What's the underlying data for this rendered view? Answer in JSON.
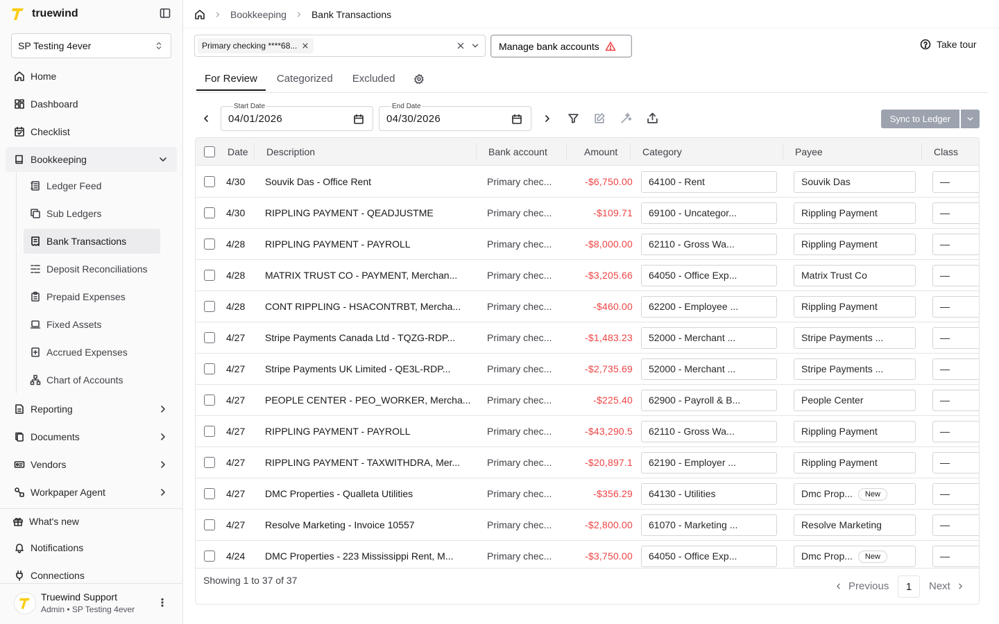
{
  "brand": {
    "name": "truewind",
    "accent": "#facc15"
  },
  "org_selector": {
    "value": "SP Testing 4ever"
  },
  "nav": {
    "home": "Home",
    "dashboard": "Dashboard",
    "checklist": "Checklist",
    "bookkeeping": "Bookkeeping",
    "bookkeeping_sub": [
      {
        "label": "Ledger Feed",
        "icon": "ledger-icon"
      },
      {
        "label": "Sub Ledgers",
        "icon": "copy-icon"
      },
      {
        "label": "Bank Transactions",
        "icon": "receipt-icon",
        "active": true
      },
      {
        "label": "Deposit Reconciliations",
        "icon": "reconcile-icon"
      },
      {
        "label": "Prepaid Expenses",
        "icon": "clipboard-icon"
      },
      {
        "label": "Fixed Assets",
        "icon": "laptop-icon"
      },
      {
        "label": "Accrued Expenses",
        "icon": "plus-file-icon"
      },
      {
        "label": "Chart of Accounts",
        "icon": "tree-icon"
      }
    ],
    "reporting": "Reporting",
    "documents": "Documents",
    "vendors": "Vendors",
    "workpaper_agent": "Workpaper Agent",
    "whats_new": "What's new",
    "notifications": "Notifications",
    "connections": "Connections"
  },
  "user": {
    "name": "Truewind Support",
    "role": "Admin • SP Testing 4ever"
  },
  "breadcrumb": {
    "parent": "Bookkeeping",
    "current": "Bank Transactions"
  },
  "account_filter": {
    "chip": "Primary checking ****68..."
  },
  "manage_button": "Manage bank accounts",
  "tour_button": "Take tour",
  "tabs": [
    "For Review",
    "Categorized",
    "Excluded"
  ],
  "dates": {
    "start_label": "Start Date",
    "start_value": "04/01/2026",
    "end_label": "End Date",
    "end_value": "04/30/2026"
  },
  "sync_button": "Sync to Ledger",
  "table": {
    "headers": {
      "date": "Date",
      "description": "Description",
      "bank": "Bank account",
      "amount": "Amount",
      "category": "Category",
      "payee": "Payee",
      "class": "Class"
    },
    "rows": [
      {
        "date": "4/30",
        "description": "Souvik Das - Office Rent",
        "bank": "Primary chec...",
        "amount": "-$6,750.00",
        "category": "64100 - Rent",
        "payee": "Souvik Das",
        "payee_new": "",
        "class": "—"
      },
      {
        "date": "4/30",
        "description": "RIPPLING PAYMENT - QEADJUSTME",
        "bank": "Primary chec...",
        "amount": "-$109.71",
        "category": "69100 - Uncategor...",
        "payee": "Rippling Payment",
        "payee_new": "",
        "class": "—"
      },
      {
        "date": "4/28",
        "description": "RIPPLING PAYMENT - PAYROLL",
        "bank": "Primary chec...",
        "amount": "-$8,000.00",
        "category": "62110 - Gross Wa...",
        "payee": "Rippling Payment",
        "payee_new": "",
        "class": "—"
      },
      {
        "date": "4/28",
        "description": "MATRIX TRUST CO - PAYMENT, Merchan...",
        "bank": "Primary chec...",
        "amount": "-$3,205.66",
        "category": "64050 - Office Exp...",
        "payee": "Matrix Trust Co",
        "payee_new": "",
        "class": "—"
      },
      {
        "date": "4/28",
        "description": "CONT RIPPLING - HSACONTRBT, Mercha...",
        "bank": "Primary chec...",
        "amount": "-$460.00",
        "category": "62200 - Employee ...",
        "payee": "Rippling Payment",
        "payee_new": "",
        "class": "—"
      },
      {
        "date": "4/27",
        "description": "Stripe Payments Canada Ltd - TQZG-RDP...",
        "bank": "Primary chec...",
        "amount": "-$1,483.23",
        "category": "52000 - Merchant ...",
        "payee": "Stripe Payments ...",
        "payee_new": "",
        "class": "—"
      },
      {
        "date": "4/27",
        "description": "Stripe Payments UK Limited - QE3L-RDP...",
        "bank": "Primary chec...",
        "amount": "-$2,735.69",
        "category": "52000 - Merchant ...",
        "payee": "Stripe Payments ...",
        "payee_new": "",
        "class": "—"
      },
      {
        "date": "4/27",
        "description": "PEOPLE CENTER - PEO_WORKER, Mercha...",
        "bank": "Primary chec...",
        "amount": "-$225.40",
        "category": "62900 - Payroll & B...",
        "payee": "People Center",
        "payee_new": "",
        "class": "—"
      },
      {
        "date": "4/27",
        "description": "RIPPLING PAYMENT - PAYROLL",
        "bank": "Primary chec...",
        "amount": "-$43,290.5",
        "category": "62110 - Gross Wa...",
        "payee": "Rippling Payment",
        "payee_new": "",
        "class": "—"
      },
      {
        "date": "4/27",
        "description": "RIPPLING PAYMENT - TAXWITHDRA, Mer...",
        "bank": "Primary chec...",
        "amount": "-$20,897.1",
        "category": "62190 - Employer ...",
        "payee": "Rippling Payment",
        "payee_new": "",
        "class": "—"
      },
      {
        "date": "4/27",
        "description": "DMC Properties - Qualleta Utilities",
        "bank": "Primary chec...",
        "amount": "-$356.29",
        "category": "64130 - Utilities",
        "payee": "Dmc Prop...",
        "payee_new": "New",
        "class": "—"
      },
      {
        "date": "4/27",
        "description": "Resolve Marketing - Invoice 10557",
        "bank": "Primary chec...",
        "amount": "-$2,800.00",
        "category": "61070 - Marketing ...",
        "payee": "Resolve Marketing",
        "payee_new": "",
        "class": "—"
      },
      {
        "date": "4/24",
        "description": "DMC Properties - 223 Mississippi Rent, M...",
        "bank": "Primary chec...",
        "amount": "-$3,750.00",
        "category": "64050 - Office Exp...",
        "payee": "Dmc Prop...",
        "payee_new": "New",
        "class": "—"
      }
    ]
  },
  "footer": {
    "showing": "Showing 1 to 37 of 37",
    "previous": "Previous",
    "page": "1",
    "next": "Next"
  },
  "colors": {
    "negative_amount": "#ef4444",
    "sync_disabled": "#9ca3af",
    "warning": "#ef4444"
  }
}
